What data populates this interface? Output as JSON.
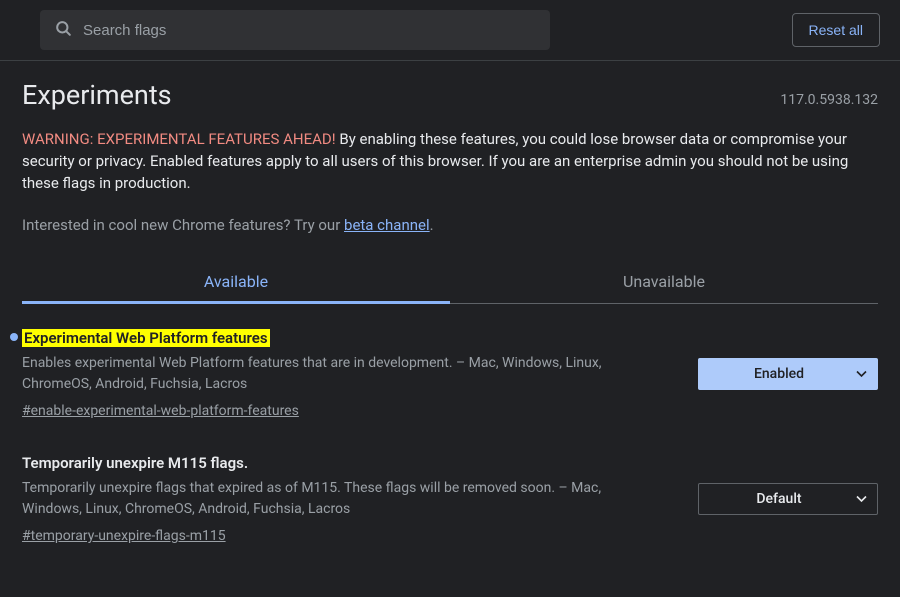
{
  "search": {
    "placeholder": "Search flags"
  },
  "reset_label": "Reset all",
  "header": {
    "title": "Experiments",
    "version": "117.0.5938.132"
  },
  "warning": {
    "prefix": "WARNING: EXPERIMENTAL FEATURES AHEAD!",
    "body": " By enabling these features, you could lose browser data or compromise your security or privacy. Enabled features apply to all users of this browser. If you are an enterprise admin you should not be using these flags in production."
  },
  "interest": {
    "text": "Interested in cool new Chrome features? Try our ",
    "link": "beta channel",
    "suffix": "."
  },
  "tabs": {
    "available": "Available",
    "unavailable": "Unavailable"
  },
  "flags": [
    {
      "title": "Experimental Web Platform features",
      "desc": "Enables experimental Web Platform features that are in development. – Mac, Windows, Linux, ChromeOS, Android, Fuchsia, Lacros",
      "anchor": "#enable-experimental-web-platform-features",
      "select_value": "Enabled",
      "highlighted": true,
      "indicator": true,
      "enabled_style": true
    },
    {
      "title": "Temporarily unexpire M115 flags.",
      "desc": "Temporarily unexpire flags that expired as of M115. These flags will be removed soon. – Mac, Windows, Linux, ChromeOS, Android, Fuchsia, Lacros",
      "anchor": "#temporary-unexpire-flags-m115",
      "select_value": "Default",
      "highlighted": false,
      "indicator": false,
      "enabled_style": false
    }
  ]
}
